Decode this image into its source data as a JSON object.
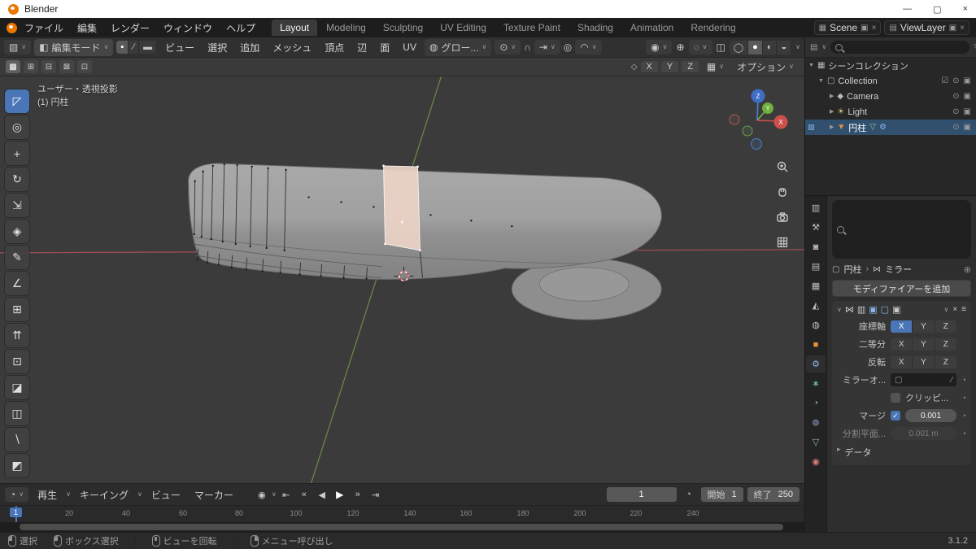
{
  "colors": {
    "accent": "#4a76b8",
    "selrow": "#31506e",
    "objorange": "#e8923c",
    "facehl": "#ecd4c6"
  },
  "titlebar": {
    "app": "Blender",
    "minimize": "—",
    "maximize": "▢",
    "close": "×"
  },
  "topbar": {
    "menus": [
      "ファイル",
      "編集",
      "レンダー",
      "ウィンドウ",
      "ヘルプ"
    ],
    "workspaces": [
      "Layout",
      "Modeling",
      "Sculpting",
      "UV Editing",
      "Texture Paint",
      "Shading",
      "Animation",
      "Rendering"
    ],
    "scene_label": "Scene",
    "viewlayer_label": "ViewLayer"
  },
  "header": {
    "mode": "編集モード",
    "menus": [
      "ビュー",
      "選択",
      "追加",
      "メッシュ",
      "頂点",
      "辺",
      "面",
      "UV"
    ],
    "orientation": "グロー...",
    "options": "オプション",
    "axis": [
      "X",
      "Y",
      "Z"
    ]
  },
  "viewport": {
    "line1": "ユーザー・透視投影",
    "line2": "(1) 円柱",
    "gizmo_x": "X",
    "gizmo_y": "Y",
    "gizmo_z": "Z"
  },
  "tools": [
    {
      "name": "select-box",
      "glyph": "◸"
    },
    {
      "name": "cursor",
      "glyph": "◎"
    },
    {
      "name": "move",
      "glyph": "+"
    },
    {
      "name": "rotate",
      "glyph": "↻"
    },
    {
      "name": "scale",
      "glyph": "⇲"
    },
    {
      "name": "transform",
      "glyph": "◈"
    },
    {
      "name": "annotate",
      "glyph": "✎"
    },
    {
      "name": "measure",
      "glyph": "∠"
    },
    {
      "name": "add-cube",
      "glyph": "⊞"
    },
    {
      "name": "extrude-region",
      "glyph": "⇈"
    },
    {
      "name": "inset-faces",
      "glyph": "⊡"
    },
    {
      "name": "bevel",
      "glyph": "◪"
    },
    {
      "name": "loop-cut",
      "glyph": "◫"
    },
    {
      "name": "knife",
      "glyph": "∖"
    },
    {
      "name": "add-primitive",
      "glyph": "◩"
    }
  ],
  "icons": {
    "chev": "∨",
    "chev_r": "▸",
    "tri_d": "▼",
    "tri_r": "▶",
    "close": "×",
    "editor_3d": "▧",
    "editor_outliner": "▤",
    "editor_timeline": "◔",
    "editor_props": "▥",
    "mode_cube": "◧",
    "vertex": "▪",
    "edge": "∕",
    "face": "▬",
    "globe": "◍",
    "pivot": "⊙",
    "magnet": "∩",
    "snap": "⇥",
    "prop_edit": "◎",
    "falloff": "◠",
    "vis": "◉",
    "gizmo": "⊕",
    "overlay": "◌",
    "xray": "◫",
    "wire": "◯",
    "solid": "●",
    "material": "◐",
    "rendered": "◒",
    "scene": "▦",
    "viewlayer": "▤",
    "dup": "▣",
    "funnel": "▽",
    "collection": "▢",
    "camera": "◆",
    "light": "☀",
    "mesh": "▼",
    "mesh_data": "▽",
    "wrench": "⚙",
    "edit_badge": "▧",
    "eye": "⊙",
    "cam": "▣",
    "check_on": "☑",
    "pin": "⊕",
    "mirror": "⋈",
    "handle": "≡",
    "dot": "•",
    "tick": "✓",
    "bsep": "›",
    "record": "◉",
    "t_start": "⇤",
    "t_pkey": "«",
    "t_rev": "◀",
    "t_play": "▶",
    "t_nkey": "»",
    "t_end": "⇥",
    "clock": "◔",
    "sm1": "▩",
    "sm2": "⊞",
    "sm3": "⊟",
    "sm4": "⊠",
    "sm5": "⊡",
    "axisik": "◇",
    "snapgrid": "▦"
  },
  "outliner": {
    "rows": [
      {
        "label": "シーンコレクション"
      },
      {
        "label": "Collection"
      },
      {
        "label": "Camera"
      },
      {
        "label": "Light"
      },
      {
        "label": "円柱"
      }
    ]
  },
  "props": {
    "tabs": [
      {
        "name": "tool",
        "glyph": "⚒",
        "color": "#bdbdbd"
      },
      {
        "name": "render",
        "glyph": "◙",
        "color": "#bdbdbd"
      },
      {
        "name": "output",
        "glyph": "▤",
        "color": "#bdbdbd"
      },
      {
        "name": "view-layer",
        "glyph": "▦",
        "color": "#bdbdbd"
      },
      {
        "name": "scene",
        "glyph": "◭",
        "color": "#bdbdbd"
      },
      {
        "name": "world",
        "glyph": "◍",
        "color": "#bdbdbd"
      },
      {
        "name": "object",
        "glyph": "■",
        "color": "#e8923c"
      },
      {
        "name": "modifiers",
        "glyph": "⚙",
        "color": "#8ab6e8"
      },
      {
        "name": "particles",
        "glyph": "∗",
        "color": "#7fc9c9"
      },
      {
        "name": "physics",
        "glyph": "◔",
        "color": "#7fc9c9"
      },
      {
        "name": "constraints",
        "glyph": "⊚",
        "color": "#9fb7e4"
      },
      {
        "name": "object-data",
        "glyph": "▽",
        "color": "#8cc98c"
      },
      {
        "name": "material",
        "glyph": "◉",
        "color": "#d97a7a"
      }
    ],
    "object": "円柱",
    "modifier": "ミラー",
    "add": "モディファイアーを追加",
    "axis": "座標軸",
    "bisect": "二等分",
    "flip": "反転",
    "mirror_obj": "ミラーオ...",
    "clipping": "クリッピ...",
    "merge": "マージ",
    "merge_val": "0.001",
    "bisect_dist": "分割平面...",
    "bisect_val": "0.001 m",
    "data": "データ",
    "xyz": [
      "X",
      "Y",
      "Z"
    ]
  },
  "timeline": {
    "menus": [
      "再生",
      "キーイング",
      "ビュー",
      "マーカー"
    ],
    "frame": "1",
    "start_label": "開始",
    "start": "1",
    "end_label": "終了",
    "end": "250",
    "playhead": "1",
    "ticks": [
      "20",
      "40",
      "60",
      "80",
      "100",
      "120",
      "140",
      "160",
      "180",
      "200",
      "220",
      "240"
    ]
  },
  "statusbar": {
    "items": [
      "選択",
      "ボックス選択",
      "ビューを回転",
      "メニュー呼び出し"
    ],
    "version": "3.1.2"
  }
}
